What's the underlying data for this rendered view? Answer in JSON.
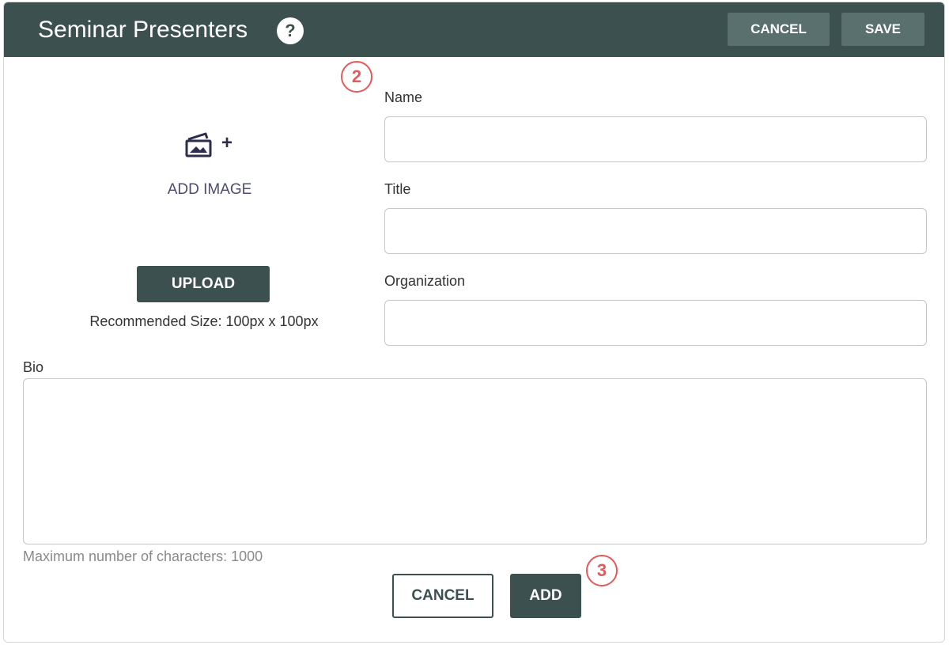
{
  "header": {
    "title": "Seminar Presenters",
    "help_icon": "?",
    "cancel_label": "CANCEL",
    "save_label": "SAVE"
  },
  "badges": {
    "step2": "2",
    "step3": "3"
  },
  "image_section": {
    "icon": "image-add-icon",
    "plus": "+",
    "add_image_label": "ADD IMAGE",
    "upload_label": "UPLOAD",
    "recommended_size": "Recommended Size: 100px x 100px"
  },
  "form": {
    "name_label": "Name",
    "name_value": "",
    "title_label": "Title",
    "title_value": "",
    "organization_label": "Organization",
    "organization_value": "",
    "bio_label": "Bio",
    "bio_value": "",
    "max_chars": "Maximum number of characters: 1000"
  },
  "footer": {
    "cancel_label": "CANCEL",
    "add_label": "ADD"
  },
  "colors": {
    "header_bg": "#3c504f",
    "header_button_bg": "#59706f",
    "badge_accent": "#e25a59",
    "icon_color": "#2d2d4d"
  }
}
